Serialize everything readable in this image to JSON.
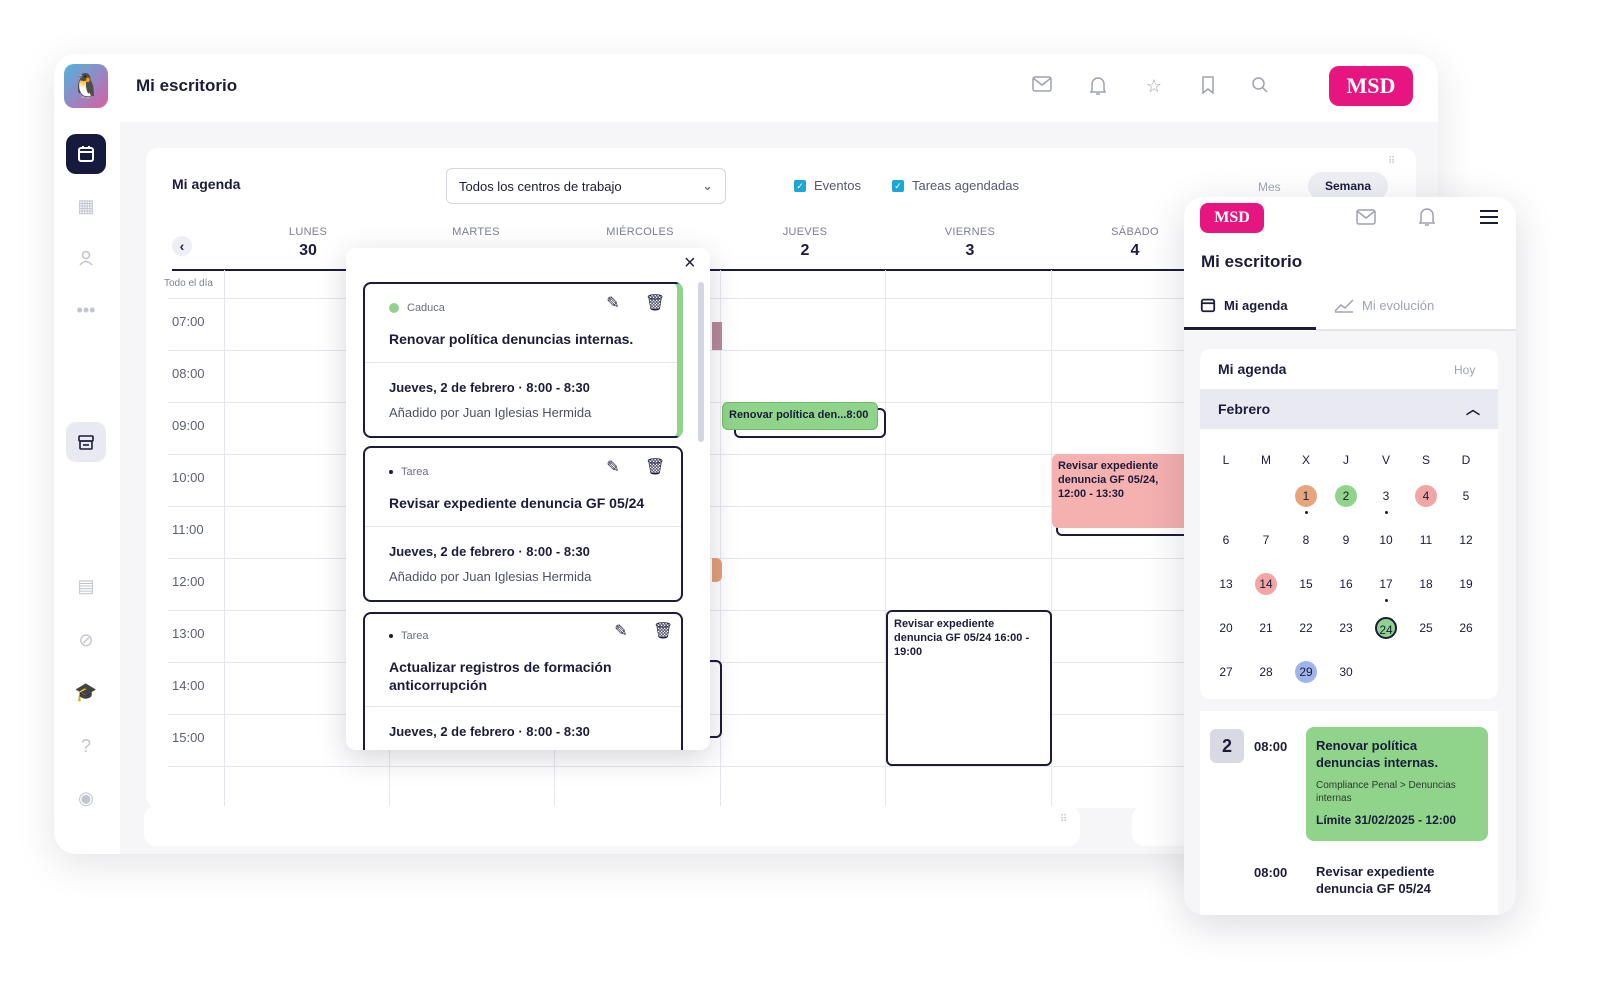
{
  "header": {
    "title": "Mi escritorio",
    "brand": "MSD"
  },
  "agenda": {
    "title": "Mi agenda",
    "select_value": "Todos los centros de trabajo",
    "filters": [
      "Eventos",
      "Tareas agendadas"
    ],
    "view_options": [
      "Mes",
      "Semana"
    ],
    "all_day_label": "Todo el día",
    "days": [
      {
        "name": "LUNES",
        "num": "30"
      },
      {
        "name": "MARTES",
        "num": ""
      },
      {
        "name": "MIÉRCOLES",
        "num": ""
      },
      {
        "name": "JUEVES",
        "num": "2"
      },
      {
        "name": "VIERNES",
        "num": "3"
      },
      {
        "name": "SÁBADO",
        "num": "4"
      }
    ],
    "hours": [
      "07:00",
      "08:00",
      "09:00",
      "10:00",
      "11:00",
      "12:00",
      "13:00",
      "14:00",
      "15:00"
    ],
    "events": [
      {
        "text": "Renovar política den...8:00"
      },
      {
        "text": "Revisar expediente denuncia GF 05/24, 12:00 - 13:30"
      },
      {
        "text": "Revisar expediente denuncia GF 05/24 16:00 - 19:00"
      }
    ]
  },
  "popup": {
    "tasks": [
      {
        "type": "Caduca",
        "title": "Renovar política denuncias internas.",
        "date": "Jueves, 2 de febrero · 8:00 - 8:30",
        "by": "Añadido por Juan Iglesias Hermida"
      },
      {
        "type": "Tarea",
        "title": "Revisar expediente denuncia GF 05/24",
        "date": "Jueves, 2 de febrero · 8:00 - 8:30",
        "by": "Añadido por Juan Iglesias Hermida"
      },
      {
        "type": "Tarea",
        "title": "Actualizar registros de formación anticorrupción",
        "date": "Jueves, 2 de febrero · 8:00 - 8:30",
        "by": ""
      }
    ],
    "colors": {
      "caduca": "#7fcf7a",
      "border": "#1b1c3a"
    }
  },
  "mobile": {
    "brand": "MSD",
    "title": "Mi escritorio",
    "tabs": [
      "Mi agenda",
      "Mi evolución"
    ],
    "card_title": "Mi agenda",
    "today": "Hoy",
    "month": "Febrero",
    "weekdays": [
      "L",
      "M",
      "X",
      "J",
      "V",
      "S",
      "D"
    ],
    "weeks": [
      [
        "",
        "",
        "1",
        "2",
        "3",
        "4",
        "5"
      ],
      [
        "6",
        "7",
        "8",
        "9",
        "10",
        "11",
        "12"
      ],
      [
        "13",
        "14",
        "15",
        "16",
        "17",
        "18",
        "19"
      ],
      [
        "20",
        "21",
        "22",
        "23",
        "24",
        "25",
        "26"
      ],
      [
        "27",
        "28",
        "29",
        "30",
        "",
        "",
        ""
      ]
    ],
    "day_badge": "2",
    "items": [
      {
        "time": "08:00",
        "title": "Renovar política denuncias internas.",
        "path": "Compliance Penal > Denuncias internas",
        "limit": "Límite 31/02/2025 - 12:00"
      },
      {
        "time": "08:00",
        "title": "Revisar expediente denuncia GF 05/24"
      }
    ]
  }
}
